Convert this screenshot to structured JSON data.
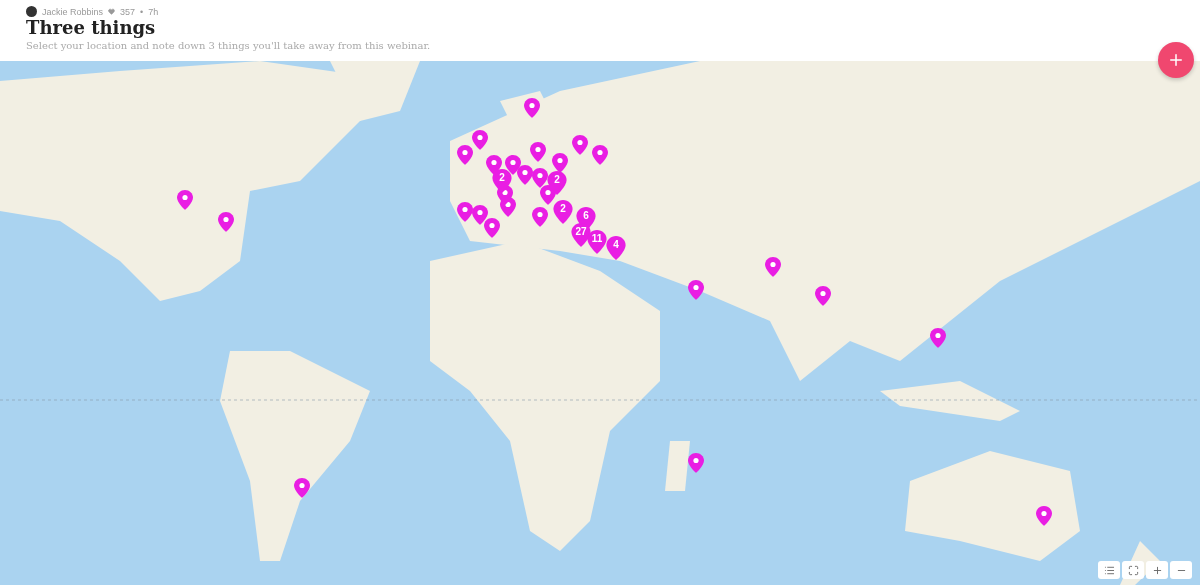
{
  "header": {
    "author": "Jackie Robbins",
    "likes": "357",
    "separator": "•",
    "age": "7h",
    "title": "Three things",
    "description": "Select your location and note down 3 things you'll take away from this webinar."
  },
  "map": {
    "kind": "picture",
    "clusters": [
      {
        "count": "2"
      },
      {
        "count": "2"
      },
      {
        "count": "2"
      },
      {
        "count": "6"
      },
      {
        "count": "27"
      },
      {
        "count": "11"
      },
      {
        "count": "4"
      }
    ]
  }
}
